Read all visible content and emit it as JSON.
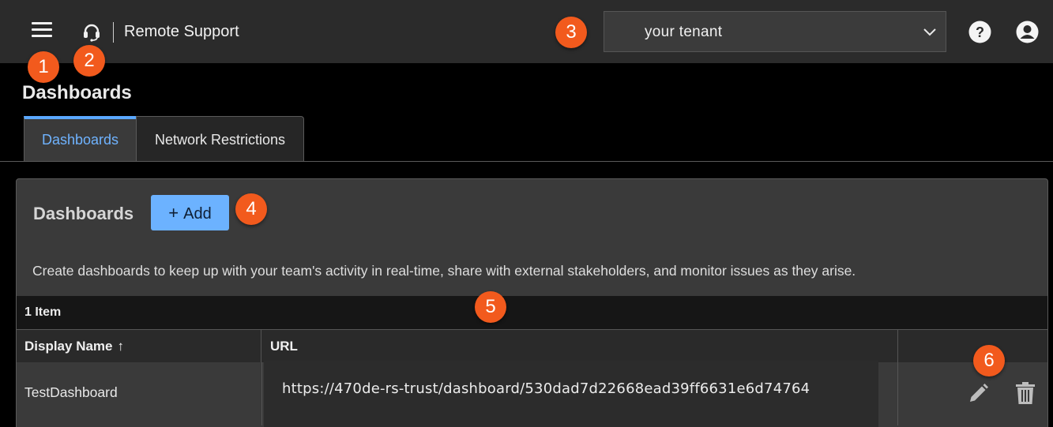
{
  "header": {
    "app_name": "Remote Support",
    "menu_icon": "hamburger-menu-icon",
    "logo_icon": "headset-icon",
    "tenant": {
      "value": "your tenant",
      "icon": "chevron-down-icon"
    },
    "help_icon": "help-circle-icon",
    "user_icon": "account-circle-icon"
  },
  "markers": [
    "1",
    "2",
    "3",
    "4",
    "5",
    "6"
  ],
  "page": {
    "title": "Dashboards"
  },
  "tabs": [
    {
      "label": "Dashboards",
      "active": true
    },
    {
      "label": "Network Restrictions",
      "active": false
    }
  ],
  "panel": {
    "title": "Dashboards",
    "add_label": "Add",
    "add_icon": "plus-icon",
    "description": "Create dashboards to keep up with your team's activity in real-time, share with external stakeholders, and monitor issues as they arise."
  },
  "table": {
    "count_label": "1 Item",
    "columns": [
      {
        "label": "Display Name",
        "sort": "ascending",
        "sort_icon": "sort-arrow-up-icon"
      },
      {
        "label": "URL"
      },
      {
        "label": ""
      }
    ],
    "rows": [
      {
        "display_name": "TestDashboard",
        "url": "https://470de-rs-trust/dashboard/530dad7d22668ead39ff6631e6d74764",
        "actions": [
          "edit-pencil-icon",
          "delete-trash-icon"
        ]
      }
    ]
  },
  "colors": {
    "accent": "#6cb2ff",
    "marker": "#f25a1d",
    "topbar": "#2b2b2b",
    "panel": "#3a3a3a"
  }
}
